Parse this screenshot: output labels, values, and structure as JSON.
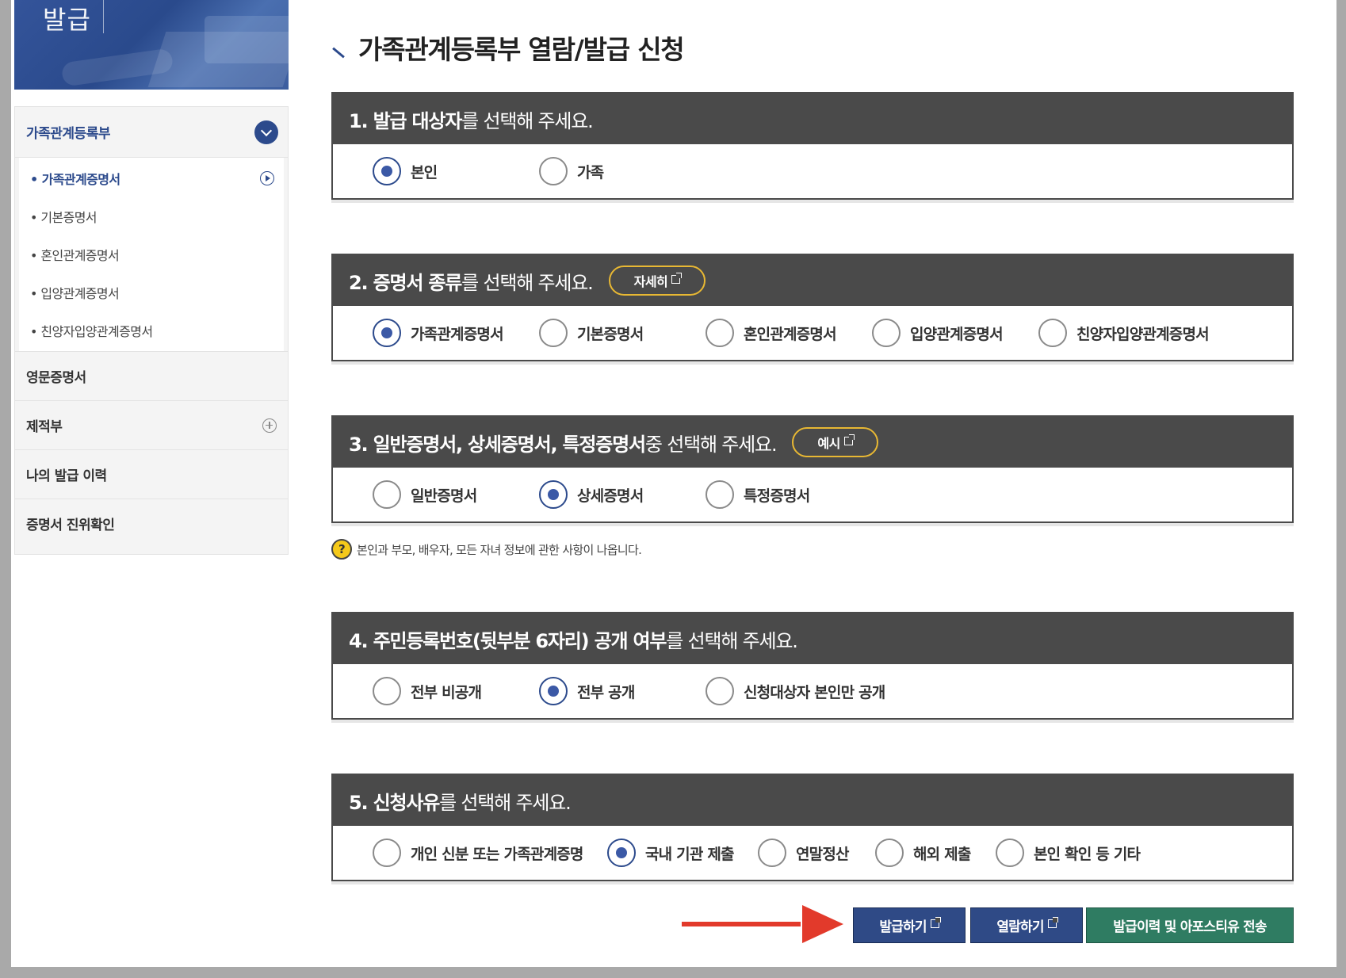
{
  "banner": {
    "text": "발급"
  },
  "sidebar": {
    "head": "가족관계등록부",
    "sub_items": [
      {
        "label": "가족관계증명서",
        "active": true
      },
      {
        "label": "기본증명서"
      },
      {
        "label": "혼인관계증명서"
      },
      {
        "label": "입양관계증명서"
      },
      {
        "label": "친양자입양관계증명서"
      }
    ],
    "items": [
      {
        "label": "영문증명서"
      },
      {
        "label": "제적부"
      },
      {
        "label": "나의 발급 이력"
      },
      {
        "label": "증명서 진위확인"
      }
    ]
  },
  "page": {
    "title": "가족관계등록부 열람/발급 신청"
  },
  "sections": [
    {
      "bold": "1. 발급 대상자",
      "rest": "를 선택해 주세요.",
      "options": [
        {
          "label": "본인",
          "checked": true
        },
        {
          "label": "가족",
          "checked": false
        }
      ]
    },
    {
      "bold": "2. 증명서 종류",
      "rest": "를 선택해 주세요.",
      "pill": "자세히",
      "options": [
        {
          "label": "가족관계증명서",
          "checked": true
        },
        {
          "label": "기본증명서",
          "checked": false
        },
        {
          "label": "혼인관계증명서",
          "checked": false
        },
        {
          "label": "입양관계증명서",
          "checked": false
        },
        {
          "label": "친양자입양관계증명서",
          "checked": false
        }
      ]
    },
    {
      "bold": "3. 일반증명서, 상세증명서, 특정증명서",
      "rest": " 중 선택해 주세요.",
      "pill": "예시",
      "options": [
        {
          "label": "일반증명서",
          "checked": false
        },
        {
          "label": "상세증명서",
          "checked": true
        },
        {
          "label": "특정증명서",
          "checked": false
        }
      ]
    },
    {
      "bold": "4. 주민등록번호(뒷부분 6자리) 공개 여부",
      "rest": "를 선택해 주세요.",
      "options": [
        {
          "label": "전부 비공개",
          "checked": false
        },
        {
          "label": "전부 공개",
          "checked": true
        },
        {
          "label": "신청대상자 본인만 공개",
          "checked": false
        }
      ]
    },
    {
      "bold": "5. 신청사유",
      "rest": "를 선택해 주세요.",
      "options": [
        {
          "label": "개인 신분 또는 가족관계증명",
          "checked": false
        },
        {
          "label": "국내 기관 제출",
          "checked": true
        },
        {
          "label": "연말정산",
          "checked": false
        },
        {
          "label": "해외 제출",
          "checked": false
        },
        {
          "label": "본인 확인 등 기타",
          "checked": false
        }
      ]
    }
  ],
  "note": {
    "icon": "?",
    "text": "본인과 부모, 배우자, 모든 자녀 정보에 관한 사항이 나옵니다."
  },
  "buttons": {
    "issue": "발급하기",
    "view": "열람하기",
    "history": "발급이력 및 아포스티유 전송"
  },
  "colors": {
    "accent": "#2c4a8c",
    "section_header": "#4a4a4a",
    "pill_border": "#e8b833",
    "green_button": "#2f7c62",
    "arrow": "#e23a2b"
  }
}
